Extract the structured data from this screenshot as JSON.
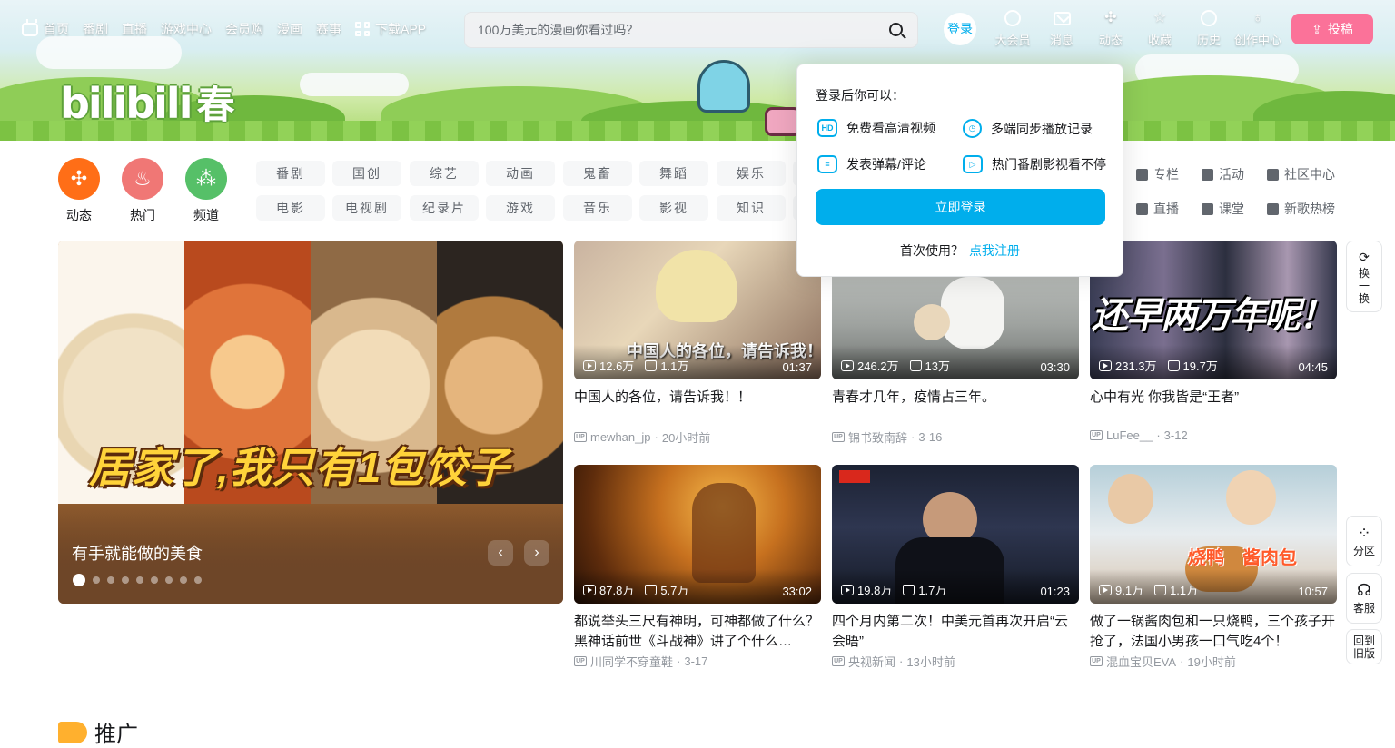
{
  "top_nav": {
    "left_items": [
      "首页",
      "番剧",
      "直播",
      "游戏中心",
      "会员购",
      "漫画",
      "赛事"
    ],
    "download_app": "下载APP",
    "search_placeholder": "100万美元的漫画你看过吗？",
    "login": "登录",
    "right_items": [
      {
        "label": "大会员",
        "icon": "vip-icon"
      },
      {
        "label": "消息",
        "icon": "message-icon"
      },
      {
        "label": "动态",
        "icon": "dynamic-icon"
      },
      {
        "label": "收藏",
        "icon": "star-icon"
      },
      {
        "label": "历史",
        "icon": "history-icon"
      },
      {
        "label": "创作中心",
        "icon": "bulb-icon"
      }
    ],
    "upload": "投稿"
  },
  "banner": {
    "logo_text": "bilibili",
    "logo_suffix": "春"
  },
  "channels": {
    "circles": [
      {
        "label": "动态",
        "color": "#ff6e17"
      },
      {
        "label": "热门",
        "color": "#f07775"
      },
      {
        "label": "频道",
        "color": "#56c068"
      }
    ],
    "tags_row1": [
      "番剧",
      "国创",
      "综艺",
      "动画",
      "鬼畜",
      "舞蹈",
      "娱乐"
    ],
    "tags_row2": [
      "电影",
      "电视剧",
      "纪录片",
      "游戏",
      "音乐",
      "影视",
      "知识"
    ],
    "right_links_row1": [
      "专栏",
      "活动",
      "社区中心"
    ],
    "right_links_row2": [
      "直播",
      "课堂",
      "新歌热榜"
    ]
  },
  "carousel": {
    "overlay_text": "居家了,我只有1包饺子",
    "caption": "有手就能做的美食",
    "total_dots": 9,
    "active_dot": 1
  },
  "videos": [
    {
      "plays": "12.6万",
      "likes": "1.1万",
      "duration": "01:37",
      "title": "中国人的各位，请告诉我！！",
      "author": "mewhan_jp",
      "time": "20小时前",
      "thumb_text": "中国人的各位，请告诉我！！"
    },
    {
      "plays": "246.2万",
      "likes": "13万",
      "duration": "03:30",
      "title": "青春才几年，疫情占三年。",
      "author": "锦书致南辞",
      "time": "3-16",
      "thumb_text": ""
    },
    {
      "plays": "231.3万",
      "likes": "19.7万",
      "duration": "04:45",
      "title": "心中有光 你我皆是“王者”",
      "author": "LuFee__",
      "time": "3-12",
      "thumb_text": "还早两万年呢！"
    },
    {
      "plays": "87.8万",
      "likes": "5.7万",
      "duration": "33:02",
      "title": "都说举头三尺有神明，可神都做了什么？黑神话前世《斗战神》讲了个什么…",
      "author": "川同学不穿童鞋",
      "time": "3-17",
      "thumb_text": ""
    },
    {
      "plays": "19.8万",
      "likes": "1.7万",
      "duration": "01:23",
      "title": "四个月内第二次！中美元首再次开启“云会晤”",
      "author": "央视新闻",
      "time": "13小时前",
      "thumb_text": ""
    },
    {
      "plays": "9.1万",
      "likes": "1.1万",
      "duration": "10:57",
      "title": "做了一锅酱肉包和一只烧鸭，三个孩子开抢了，法国小男孩一口气吃4个！",
      "author": "混血宝贝EVA",
      "time": "19小时前",
      "thumb_text": "烧鸭　酱肉包"
    }
  ],
  "popover": {
    "heading": "登录后你可以：",
    "features": [
      "免费看高清视频",
      "多端同步播放记录",
      "发表弹幕/评论",
      "热门番剧影视看不停"
    ],
    "login_button": "立即登录",
    "first_use": "首次使用？",
    "register": "点我注册"
  },
  "floating": {
    "refresh": [
      "换",
      "一",
      "换"
    ],
    "section": "分区",
    "service": "客服",
    "old_version": [
      "回到",
      "旧版"
    ]
  },
  "promo": {
    "title": "推广"
  }
}
